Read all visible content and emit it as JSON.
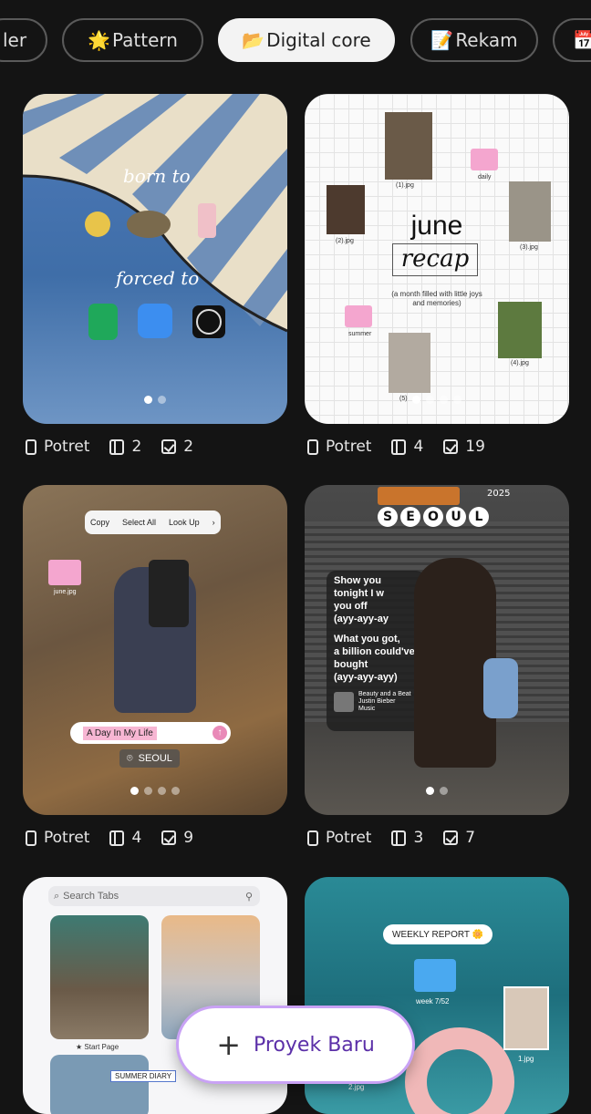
{
  "tabs": [
    {
      "emoji": "",
      "label": "ler"
    },
    {
      "emoji": "🌟",
      "label": "Pattern"
    },
    {
      "emoji": "📂",
      "label": "Digital core"
    },
    {
      "emoji": "📝",
      "label": "Rekam"
    },
    {
      "emoji": "📅",
      "label": ""
    }
  ],
  "cards": [
    {
      "title_top": "born to",
      "title_bottom": "forced to",
      "meta": {
        "orientation": "Potret",
        "pages": "2",
        "tasks": "2"
      }
    },
    {
      "title": "june",
      "script_title": "recap",
      "subtitle": "(a month filled with little joys and memories)",
      "files": [
        "(1).jpg",
        "daily",
        "(2).jpg",
        "(3).jpg",
        "summer",
        "(4).jpg",
        "(5)"
      ],
      "meta": {
        "orientation": "Potret",
        "pages": "4",
        "tasks": "19"
      }
    },
    {
      "menu": [
        "Copy",
        "Select All",
        "Look Up"
      ],
      "folder_label": "june.jpg",
      "search_text": "A Day In My Life",
      "location": "SEOUL",
      "meta": {
        "orientation": "Potret",
        "pages": "4",
        "tasks": "9"
      }
    },
    {
      "city": [
        "S",
        "E",
        "O",
        "U",
        "L"
      ],
      "badge": "2025",
      "lyrics": [
        "Show you",
        "tonight I w",
        "you off",
        "(ayy-ayy-ay",
        "",
        "What you got,",
        "a billion could've",
        "bought",
        "(ayy-ayy-ayy)"
      ],
      "song": "Beauty and a Beat",
      "artist": "Justin Bieber",
      "service": "Music",
      "meta": {
        "orientation": "Potret",
        "pages": "3",
        "tasks": "7"
      }
    },
    {
      "search_placeholder": "Search Tabs",
      "caption1": "★ Start Page",
      "caption2": "SUMMER DIARY"
    },
    {
      "report": "WEEKLY REPORT 🌼",
      "folder_label": "week 7/52",
      "file1": "1.jpg",
      "file2": "2.jpg"
    }
  ],
  "fab": {
    "plus": "+",
    "label": "Proyek Baru"
  }
}
